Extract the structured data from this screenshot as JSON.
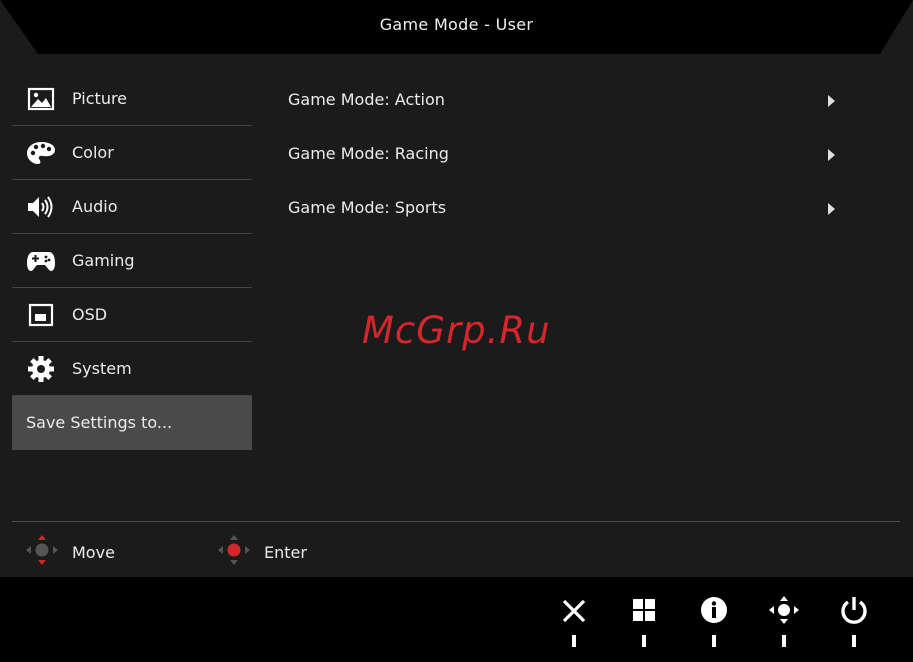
{
  "header": {
    "title": "Game Mode - User"
  },
  "sidebar": {
    "items": [
      {
        "label": "Picture",
        "icon": "picture-icon"
      },
      {
        "label": "Color",
        "icon": "palette-icon"
      },
      {
        "label": "Audio",
        "icon": "speaker-icon"
      },
      {
        "label": "Gaming",
        "icon": "gamepad-icon"
      },
      {
        "label": "OSD",
        "icon": "osd-window-icon"
      },
      {
        "label": "System",
        "icon": "gear-icon"
      },
      {
        "label": "Save Settings to..."
      }
    ],
    "selected_index": 6
  },
  "menu": {
    "items": [
      {
        "label": "Game Mode: Action"
      },
      {
        "label": "Game Mode: Racing"
      },
      {
        "label": "Game Mode: Sports"
      }
    ]
  },
  "watermark": "McGrp.Ru",
  "hints": {
    "move": "Move",
    "enter": "Enter"
  },
  "buttons": [
    "close-icon",
    "grid-icon",
    "info-icon",
    "navigate-icon",
    "power-icon"
  ],
  "colors": {
    "background": "#1b1b1b",
    "selected": "#4a4a4a",
    "accent_red": "#d4262b"
  }
}
